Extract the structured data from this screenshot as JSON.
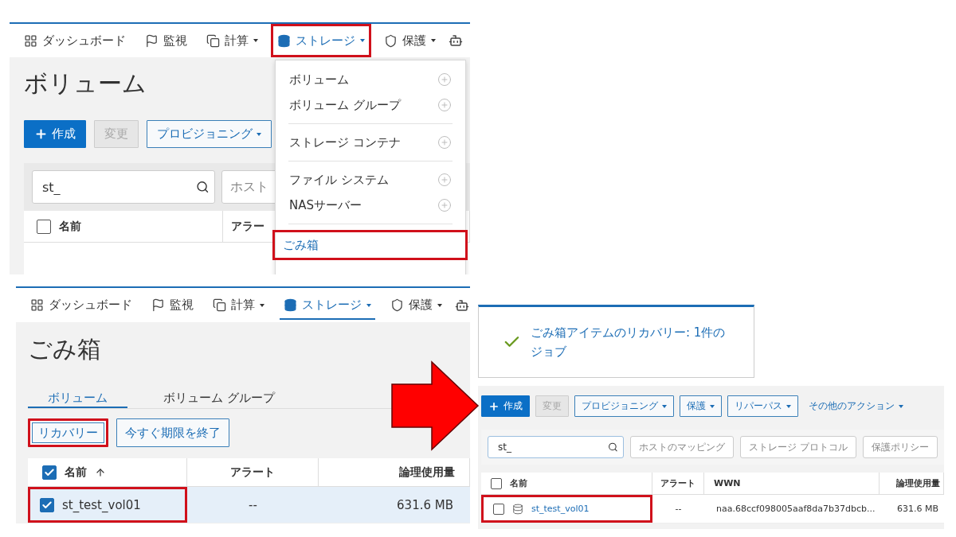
{
  "step1": {
    "nav": [
      {
        "label": "ダッシュボード",
        "menu": false,
        "selected": false,
        "open": false,
        "highlighted": false
      },
      {
        "label": "監視",
        "menu": false,
        "selected": false,
        "open": false,
        "highlighted": false
      },
      {
        "label": "計算",
        "menu": true,
        "selected": false,
        "open": false,
        "highlighted": false
      },
      {
        "label": "ストレージ",
        "menu": true,
        "selected": false,
        "open": true,
        "highlighted": true
      },
      {
        "label": "保護",
        "menu": true,
        "selected": false,
        "open": false,
        "highlighted": false
      }
    ],
    "nav_more": true,
    "title": "ボリューム",
    "buttons": [
      {
        "label": "作成",
        "kind": "primary"
      },
      {
        "label": "変更",
        "kind": "disabled"
      },
      {
        "label": "プロビジョニング",
        "kind": "menu"
      }
    ],
    "search": {
      "value": "st_"
    },
    "filters": [
      "ホスト"
    ],
    "select_all": false,
    "columns": [
      "名前",
      "アラー"
    ],
    "menu": [
      [
        {
          "label": "ボリューム",
          "kind": "add",
          "highlighted": false
        },
        {
          "label": "ボリューム グループ",
          "kind": "add",
          "highlighted": false
        }
      ],
      [
        {
          "label": "ストレージ コンテナ",
          "kind": "add",
          "highlighted": false
        }
      ],
      [
        {
          "label": "ファイル システム",
          "kind": "add",
          "highlighted": false
        },
        {
          "label": "NASサーバー",
          "kind": "add",
          "highlighted": false
        }
      ],
      [
        {
          "label": "ごみ箱",
          "kind": "link",
          "highlighted": true
        }
      ]
    ]
  },
  "step2": {
    "nav": [
      {
        "label": "ダッシュボード",
        "menu": false,
        "selected": false,
        "open": false,
        "highlighted": false
      },
      {
        "label": "監視",
        "menu": false,
        "selected": false,
        "open": false,
        "highlighted": false
      },
      {
        "label": "計算",
        "menu": true,
        "selected": false,
        "open": false,
        "highlighted": false
      },
      {
        "label": "ストレージ",
        "menu": true,
        "selected": true,
        "open": false,
        "highlighted": false
      },
      {
        "label": "保護",
        "menu": true,
        "selected": false,
        "open": false,
        "highlighted": false
      }
    ],
    "nav_more": true,
    "title": "ごみ箱",
    "tabs": [
      {
        "label": "ボリューム",
        "selected": true
      },
      {
        "label": "ボリューム グループ",
        "selected": false
      }
    ],
    "buttons": [
      {
        "label": "リカバリー",
        "kind": "outline",
        "highlighted": true
      },
      {
        "label": "今すぐ期限を終了",
        "kind": "outline",
        "highlighted": false
      }
    ],
    "select_all": true,
    "columns": [
      {
        "label": "名前",
        "sorted": true
      },
      {
        "label": "アラート",
        "sorted": false
      },
      {
        "label": "論理使用量",
        "sorted": false
      }
    ],
    "rows": [
      {
        "checked": true,
        "selected": true,
        "highlighted": true,
        "cells": [
          "st_test_vol01",
          "--",
          "631.6 MB"
        ]
      }
    ]
  },
  "step3": {
    "notice": {
      "text": "ごみ箱アイテムのリカバリー: 1件のジョブ"
    },
    "buttons": [
      {
        "label": "作成",
        "kind": "primary"
      },
      {
        "label": "変更",
        "kind": "disabled"
      },
      {
        "label": "プロビジョニング",
        "kind": "menu"
      },
      {
        "label": "保護",
        "kind": "menu"
      },
      {
        "label": "リパーパス",
        "kind": "menu"
      },
      {
        "label": "その他のアクション",
        "kind": "link"
      }
    ],
    "search": {
      "value": "st_"
    },
    "filters": [
      "ホストのマッピング",
      "ストレージ プロトコル",
      "保護ポリシー"
    ],
    "select_all": false,
    "columns": [
      "名前",
      "アラート",
      "WWN",
      "論理使用量"
    ],
    "rows": [
      {
        "checked": false,
        "highlighted": true,
        "cells": [
          "st_test_vol01",
          "--",
          "naa.68ccf098005aaf8da7b37dbcb...",
          "631.6 MB"
        ]
      }
    ]
  }
}
